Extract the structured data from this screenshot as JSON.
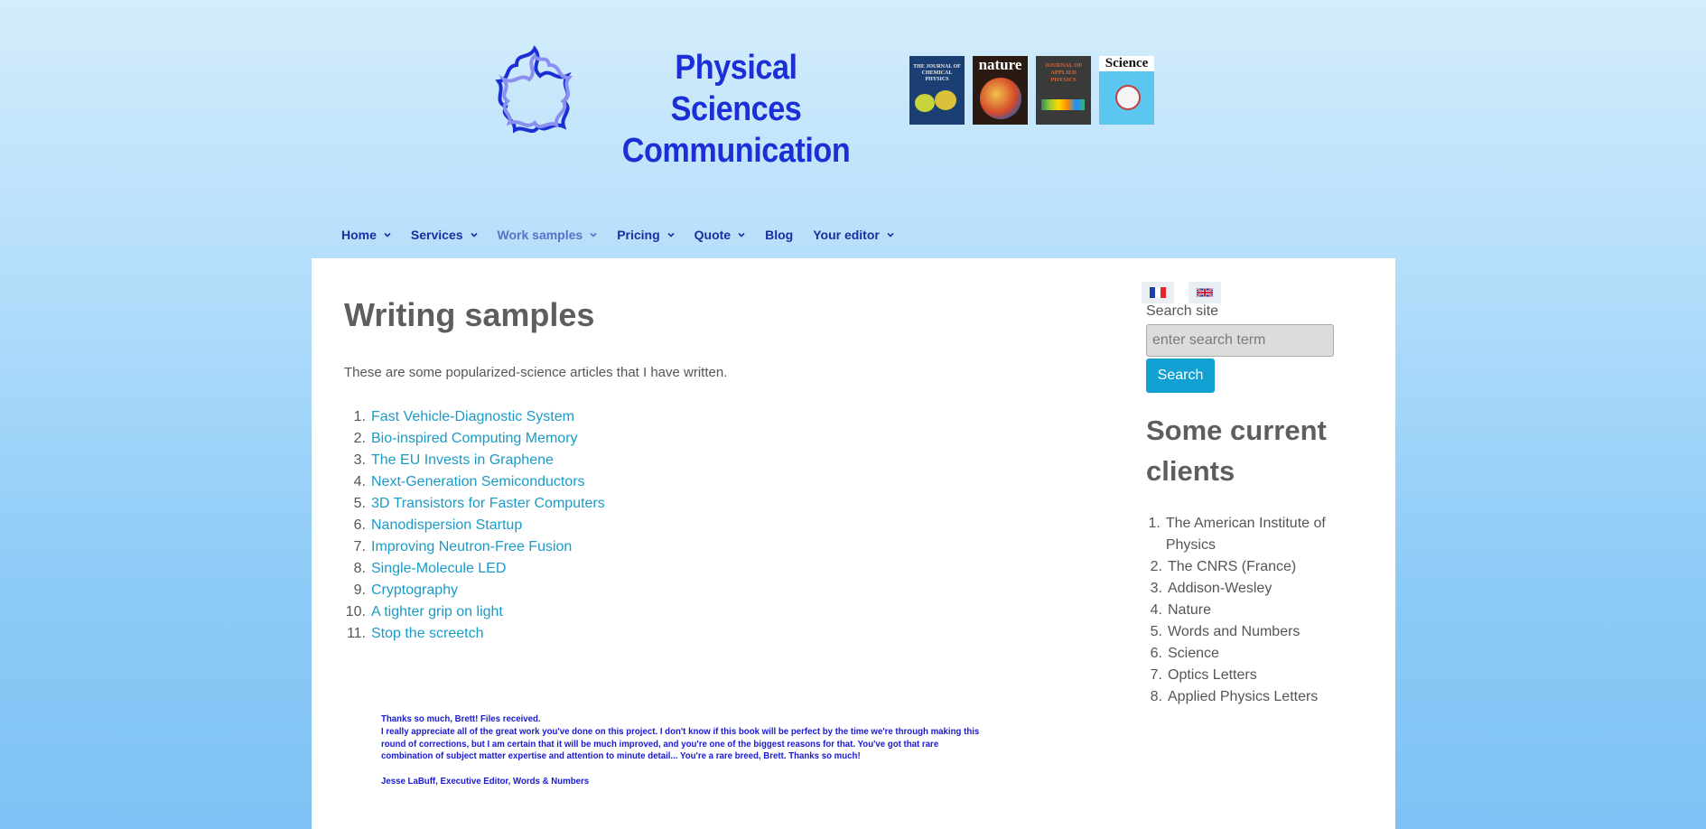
{
  "header": {
    "title_line1": "Physical Sciences",
    "title_line2": "Communication",
    "covers": [
      {
        "label": "THE JOURNAL OF CHEMICAL PHYSICS",
        "color": "#1c3f73"
      },
      {
        "label": "nature",
        "color": "#2b1a12"
      },
      {
        "label": "JOURNAL OF APPLIED PHYSICS",
        "color": "#3a3a3a"
      },
      {
        "label": "Science",
        "color": "#5cc7ee"
      }
    ]
  },
  "nav": [
    {
      "label": "Home",
      "dropdown": true
    },
    {
      "label": "Services",
      "dropdown": true
    },
    {
      "label": "Work samples",
      "dropdown": true,
      "active": true
    },
    {
      "label": "Pricing",
      "dropdown": true
    },
    {
      "label": "Quote",
      "dropdown": true
    },
    {
      "label": "Blog",
      "dropdown": false
    },
    {
      "label": "Your editor",
      "dropdown": true
    }
  ],
  "main": {
    "title": "Writing samples",
    "intro": "These are some popularized-science articles that I have written.",
    "articles": [
      "Fast Vehicle-Diagnostic System",
      "Bio-inspired Computing Memory",
      "The EU Invests in Graphene",
      "Next-Generation Semiconductors",
      "3D Transistors for Faster Computers",
      "Nanodispersion Startup",
      "Improving Neutron-Free Fusion",
      "Single-Molecule LED",
      "Cryptography",
      "A tighter grip on light",
      "Stop the screetch"
    ],
    "testimonial": {
      "line1": "Thanks so much, Brett! Files received.",
      "body": "I really appreciate all of the great work you've done on this project. I don't know if this book will be perfect by the time we're through making this round of corrections, but I am certain that it will be much improved, and you're one of the biggest reasons for that. You've got that rare combination of subject matter expertise and attention to minute detail... You're a rare breed, Brett. Thanks so much!",
      "signature": "Jesse LaBuff, Executive Editor, Words & Numbers"
    }
  },
  "sidebar": {
    "languages": [
      "fr-flag-icon",
      "uk-flag-icon"
    ],
    "search_label": "Search site",
    "search_placeholder": "enter search term",
    "search_button": "Search",
    "clients_title": "Some current clients",
    "clients": [
      "The American Institute of Physics",
      "The CNRS (France)",
      "Addison-Wesley",
      "Nature",
      "Words and Numbers",
      "Science",
      "Optics Letters",
      "Applied Physics Letters"
    ]
  },
  "colors": {
    "brand_blue": "#1a2fd6",
    "link": "#1a9bc7",
    "button": "#12a0d3"
  }
}
